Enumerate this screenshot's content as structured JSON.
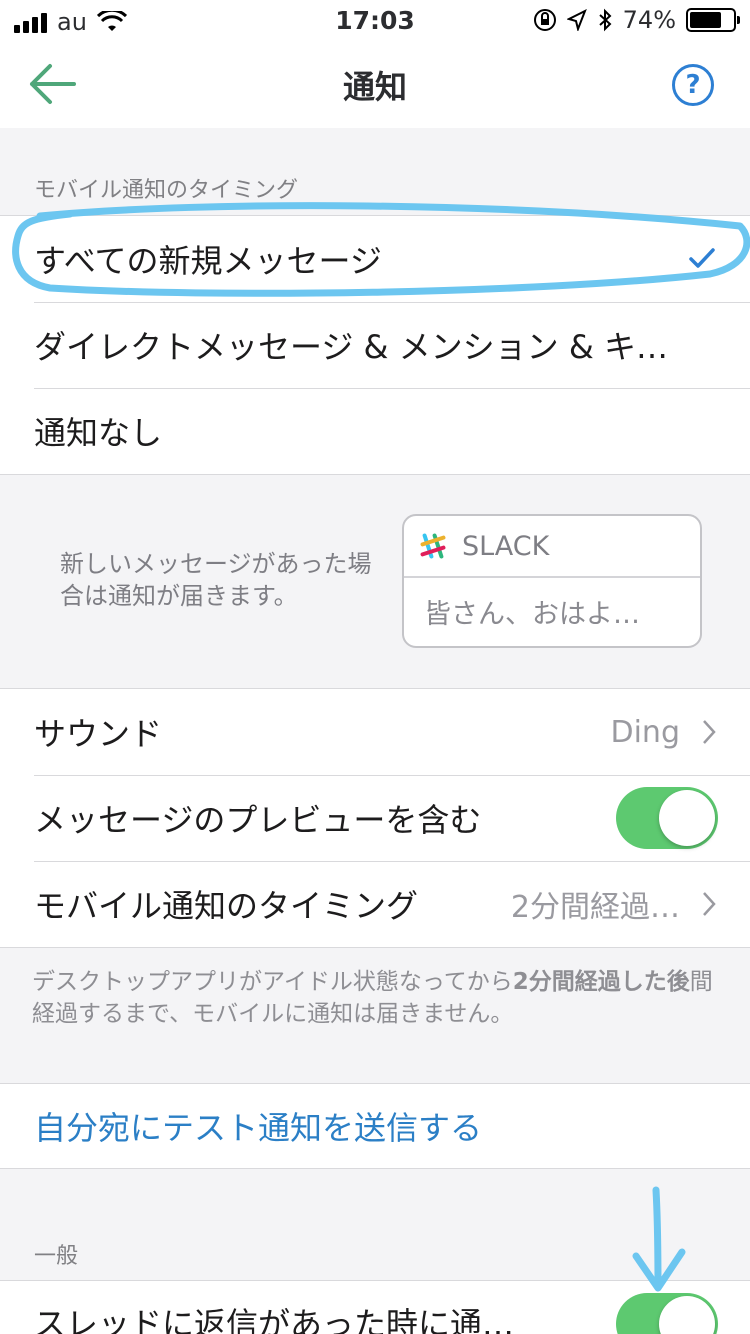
{
  "status_bar": {
    "carrier": "au",
    "time": "17:03",
    "battery": "74%",
    "battery_level": 0.74
  },
  "nav": {
    "title": "通知",
    "help_label": "?"
  },
  "timing_section": {
    "header": "モバイル通知のタイミング",
    "options": [
      {
        "label": "すべての新規メッセージ",
        "selected": true
      },
      {
        "label": "ダイレクトメッセージ & メンション & キ…",
        "selected": false
      },
      {
        "label": "通知なし",
        "selected": false
      }
    ]
  },
  "preview": {
    "description": "新しいメッセージがあった場合は通知が届きます。",
    "card_app": "SLACK",
    "card_text": "皆さん、おはよ…"
  },
  "settings": {
    "sound_label": "サウンド",
    "sound_value": "Ding",
    "preview_label": "メッセージのプレビューを含む",
    "preview_on": true,
    "timing_label": "モバイル通知のタイミング",
    "timing_value": "2分間経過…"
  },
  "footnote": {
    "part1": "デスクトップアプリがアイドル状態なってから",
    "bold1": "2分間経過した後",
    "part2": "間経過するまで、モバイルに通知は届きません。"
  },
  "test_link": "自分宛にテスト通知を送信する",
  "general_section": {
    "header": "一般",
    "thread_label": "スレッドに返信があった時に通…",
    "thread_on": true
  },
  "colors": {
    "toggle_on": "#5dc970",
    "accent": "#2d7fd3",
    "back_arrow": "#4fa77a",
    "annotation": "#6cc6f0"
  }
}
